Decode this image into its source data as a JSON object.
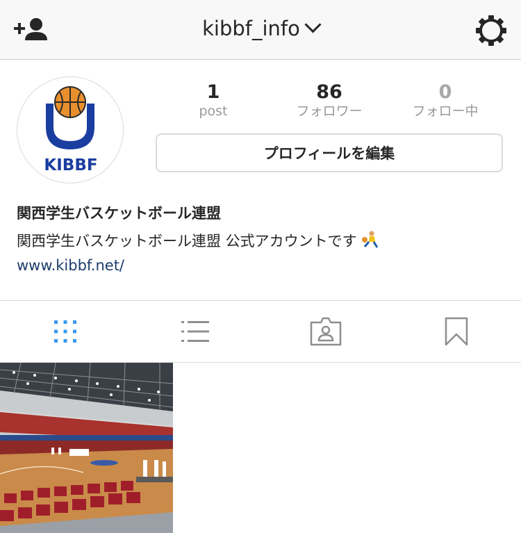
{
  "header": {
    "username": "kibbf_info",
    "icons": [
      "add-user-icon",
      "chevron-down-icon",
      "gear-icon"
    ]
  },
  "profile": {
    "avatar_text": "KIBBF",
    "stats": [
      {
        "value": "1",
        "label": "post"
      },
      {
        "value": "86",
        "label": "フォロワー"
      },
      {
        "value": "0",
        "label": "フォロー中"
      }
    ],
    "edit_label": "プロフィールを編集",
    "name": "関西学生バスケットボール連盟",
    "bio": "関西学生バスケットボール連盟 公式アカウントです",
    "bio_emoji": "basketball-player-icon",
    "website": "www.kibbf.net/"
  },
  "tabs": [
    {
      "icon": "grid-icon",
      "active": true
    },
    {
      "icon": "list-icon",
      "active": false
    },
    {
      "icon": "tagged-icon",
      "active": false
    },
    {
      "icon": "bookmark-icon",
      "active": false
    }
  ],
  "colors": {
    "active_tab": "#3897f0",
    "inactive_tab": "#8e8e8e",
    "link": "#1d3c6b",
    "logo_blue": "#1a3da0",
    "logo_orange": "#e8902e"
  },
  "posts": [
    {
      "thumbnail": "basketball-arena-photo"
    }
  ]
}
